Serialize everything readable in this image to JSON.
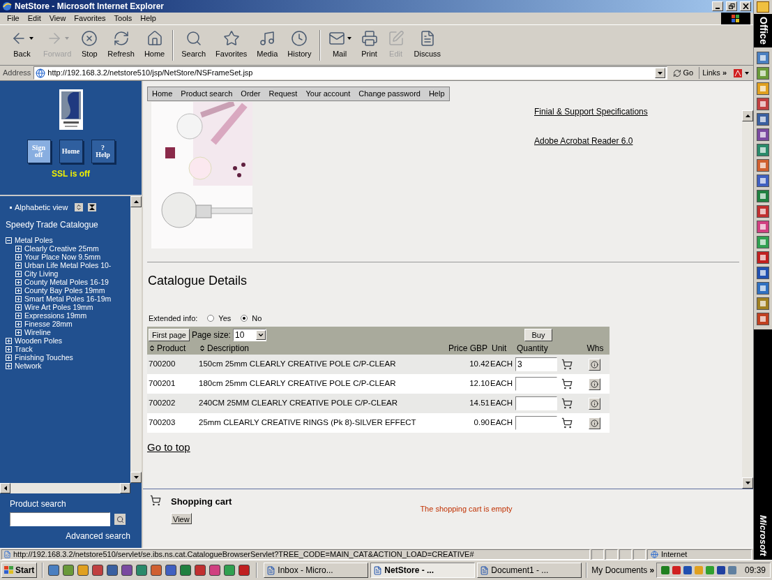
{
  "window": {
    "title": "NetStore - Microsoft Internet Explorer"
  },
  "menu": [
    "File",
    "Edit",
    "View",
    "Favorites",
    "Tools",
    "Help"
  ],
  "toolbar": [
    {
      "label": "Back",
      "disabled": false,
      "dropdown": true
    },
    {
      "label": "Forward",
      "disabled": true,
      "dropdown": true
    },
    {
      "label": "Stop",
      "disabled": false,
      "dropdown": false
    },
    {
      "label": "Refresh",
      "disabled": false,
      "dropdown": false
    },
    {
      "label": "Home",
      "disabled": false,
      "dropdown": false
    },
    {
      "label": "Search",
      "disabled": false,
      "dropdown": false
    },
    {
      "label": "Favorites",
      "disabled": false,
      "dropdown": false
    },
    {
      "label": "Media",
      "disabled": false,
      "dropdown": false
    },
    {
      "label": "History",
      "disabled": false,
      "dropdown": false
    },
    {
      "label": "Mail",
      "disabled": false,
      "dropdown": true
    },
    {
      "label": "Print",
      "disabled": false,
      "dropdown": false
    },
    {
      "label": "Edit",
      "disabled": true,
      "dropdown": false
    },
    {
      "label": "Discuss",
      "disabled": false,
      "dropdown": false
    }
  ],
  "address_bar": {
    "label": "Address",
    "url": "http://192.168.3.2/netstore510/jsp/NetStore/NSFrameSet.jsp",
    "go": "Go",
    "links": "Links",
    "more": "»"
  },
  "office_bar": {
    "top_label": "Office",
    "bottom_label": "Microsoft"
  },
  "sidebar": {
    "buttons": [
      {
        "lines": [
          "Sign",
          "off"
        ],
        "selected": true
      },
      {
        "lines": [
          "Home"
        ],
        "selected": false
      },
      {
        "lines": [
          "?",
          "Help"
        ],
        "selected": false
      }
    ],
    "ssl_status": "SSL is off",
    "view_link": "Alphabetic view",
    "catalogue_title": "Speedy Trade Catalogue",
    "tree": [
      {
        "label": "Metal Poles",
        "expanded": true,
        "children": [
          {
            "label": "Clearly Creative 25mm",
            "expanded": false
          },
          {
            "label": "Your Place Now 9.5mm",
            "expanded": false
          },
          {
            "label": "Urban Life Metal Poles 10-",
            "expanded": false
          },
          {
            "label": "City Living",
            "expanded": false
          },
          {
            "label": "County Metal Poles 16-19",
            "expanded": false
          },
          {
            "label": "County Bay Poles 19mm",
            "expanded": false
          },
          {
            "label": "Smart Metal Poles 16-19m",
            "expanded": false
          },
          {
            "label": "Wire Art Poles 19mm",
            "expanded": false
          },
          {
            "label": "Expressions 19mm",
            "expanded": false
          },
          {
            "label": "Finesse 28mm",
            "expanded": false
          },
          {
            "label": "Wireline",
            "expanded": false
          }
        ]
      },
      {
        "label": "Wooden Poles",
        "expanded": false
      },
      {
        "label": "Track",
        "expanded": false
      },
      {
        "label": "Finishing Touches",
        "expanded": false
      },
      {
        "label": "Network",
        "expanded": false
      }
    ],
    "product_search": {
      "label": "Product search",
      "advanced_link": "Advanced search"
    }
  },
  "nav": [
    "Home",
    "Product search",
    "Order",
    "Request",
    "Your account",
    "Change password",
    "Help"
  ],
  "links": [
    "Finial & Support Specifications",
    "Adobe Acrobat Reader 6.0"
  ],
  "catalogue": {
    "title": "Catalogue Details",
    "extended_info": {
      "label": "Extended info:",
      "options": [
        {
          "label": "Yes",
          "selected": false
        },
        {
          "label": "No",
          "selected": true
        }
      ]
    },
    "first_page": "First page",
    "page_size_label": "Page size:",
    "page_size": "10",
    "buy": "Buy",
    "columns": [
      {
        "label": "Product",
        "sortable": true
      },
      {
        "label": "Description",
        "sortable": true
      },
      {
        "label": "Price GBP",
        "sortable": false
      },
      {
        "label": "Unit",
        "sortable": false
      },
      {
        "label": "Quantity",
        "sortable": false
      },
      {
        "label": "Whs",
        "sortable": false
      }
    ],
    "rows": [
      {
        "product": "700200",
        "description": "150cm 25mm CLEARLY CREATIVE POLE C/P-CLEAR",
        "price": "10.42",
        "unit": "EACH",
        "quantity": "3"
      },
      {
        "product": "700201",
        "description": "180cm 25mm CLEARLY CREATIVE POLE C/P-CLEAR",
        "price": "12.10",
        "unit": "EACH"
      },
      {
        "product": "700202",
        "description": "240CM 25MM CLEARLY CREATIVE POLE C/P-CLEAR",
        "price": "14.51",
        "unit": "EACH"
      },
      {
        "product": "700203",
        "description": "25mm CLEARLY CREATIVE RINGS (Pk 8)-SILVER EFFECT",
        "price": "0.90",
        "unit": "EACH"
      }
    ],
    "top_link": "Go to top"
  },
  "cart": {
    "title": "Shopping cart",
    "view": "View",
    "message": "The shopping cart is empty"
  },
  "status_bar": {
    "url": "http://192.168.3.2/netstore510/servlet/se.ibs.ns.cat.CatalogueBrowserServlet?TREE_CODE=MAIN_CAT&ACTION_LOAD=CREATIVE#",
    "zone": "Internet"
  },
  "taskbar": {
    "start": "Start",
    "tasks": [
      {
        "label": "Inbox - Micro...",
        "selected": false
      },
      {
        "label": "NetStore - ...",
        "selected": true
      },
      {
        "label": "Document1 - ...",
        "selected": false
      }
    ],
    "toolbar_label": "My Documents",
    "more": "»",
    "clock": "09:39"
  }
}
